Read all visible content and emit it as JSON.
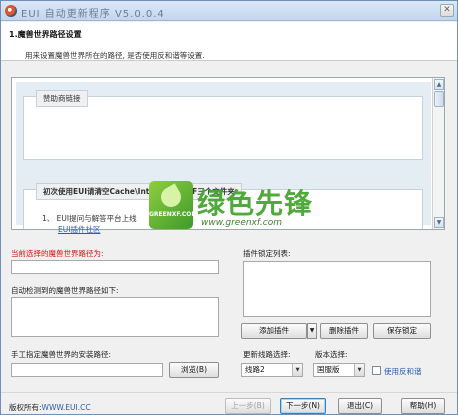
{
  "window": {
    "title": "EUI 自动更新程序 V5.0.0.4",
    "close_glyph": "✕",
    "app_icon": "eui-app-icon"
  },
  "header": {
    "step_title": "1.魔兽世界路径设置",
    "description": "用来设置魔兽世界所在的路径, 是否使用反和谐等设置."
  },
  "browser": {
    "box1_caption": "赞助商链接",
    "box2_caption": "初次使用EUI请清空Cache\\Interface\\WTF三个文件夹",
    "box2_line1": "1、 EUI提问与解答平台上线",
    "box2_line2": "EUI插件社区",
    "scroll_up": "▲",
    "scroll_down": "▼"
  },
  "watermark": {
    "tile_text": "GREENXF.COM",
    "brand_cn": "绿色先锋",
    "url": "www.greenxf.com"
  },
  "left": {
    "current_path_label": "当前选择的魔兽世界路径为:",
    "current_path_value": "",
    "detected_label": "自动检测到的魔兽世界路径如下:",
    "manual_label": "手工指定魔兽世界的安装路径:",
    "manual_value": "",
    "browse_button": "浏览(B)"
  },
  "right": {
    "plugin_list_label": "插件锁定列表:",
    "add_plugin_button": "添加插件",
    "add_plugin_arrow": "▼",
    "delete_plugin_button": "删除插件",
    "save_lock_button": "保存锁定",
    "route_label": "更新线路选择:",
    "route_value": "线路2",
    "version_label": "版本选择:",
    "version_value": "国服版",
    "anti_harmony_label": "使用反和谐",
    "anti_harmony_checked": false,
    "dropdown_arrow": "▼"
  },
  "footer": {
    "copyright_prefix": "版权所有:",
    "copyright_link": "WWW.EUI.CC",
    "prev_button": "上一步(B)",
    "next_button": "下一步(N)",
    "exit_button": "退出(C)",
    "help_button": "帮助(H)"
  }
}
